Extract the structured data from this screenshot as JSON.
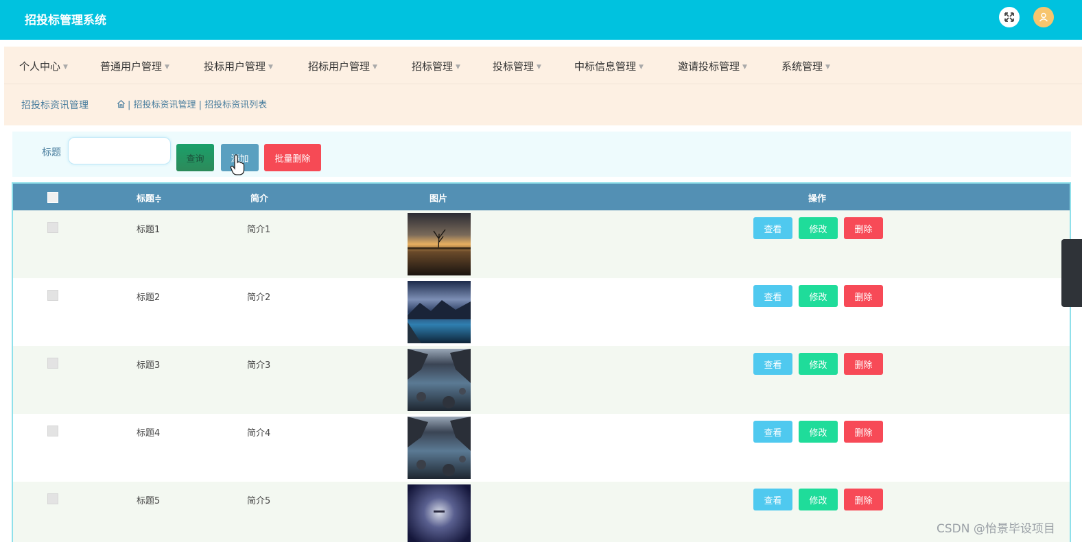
{
  "app": {
    "title": "招投标管理系统"
  },
  "header": {
    "icons": [
      "fullscreen-icon",
      "user-icon"
    ]
  },
  "nav": {
    "items": [
      {
        "label": "个人中心"
      },
      {
        "label": "普通用户管理"
      },
      {
        "label": "投标用户管理"
      },
      {
        "label": "招标用户管理"
      },
      {
        "label": "招标管理"
      },
      {
        "label": "投标管理"
      },
      {
        "label": "中标信息管理"
      },
      {
        "label": "邀请投标管理"
      },
      {
        "label": "系统管理"
      }
    ]
  },
  "breadcrumb": {
    "title": "招投标资讯管理",
    "path": "| 招投标资讯管理 | 招投标资讯列表"
  },
  "search": {
    "label": "标题",
    "value": "",
    "query_label": "查询",
    "add_label": "添加",
    "batch_delete_label": "批量删除"
  },
  "table": {
    "headers": {
      "title": "标题≑",
      "intro": "简介",
      "image": "图片",
      "actions": "操作"
    },
    "actions": {
      "view": "查看",
      "edit": "修改",
      "delete": "删除"
    },
    "rows": [
      {
        "title": "标题1",
        "intro": "简介1",
        "image": "sunset-lake-tree"
      },
      {
        "title": "标题2",
        "intro": "简介2",
        "image": "mountain-lake-blue"
      },
      {
        "title": "标题3",
        "intro": "简介3",
        "image": "river-rocks-valley"
      },
      {
        "title": "标题4",
        "intro": "简介4",
        "image": "river-rocks-valley"
      },
      {
        "title": "标题5",
        "intro": "简介5",
        "image": "night-sky-glow"
      }
    ]
  },
  "watermark": "CSDN @怡景毕设项目",
  "colors": {
    "topbar": "#00c2df",
    "nav_bg": "#fdf0e3",
    "table_header": "#5390b4",
    "view": "#4fc9ef",
    "edit": "#1fdc9a",
    "delete": "#f74a57"
  }
}
